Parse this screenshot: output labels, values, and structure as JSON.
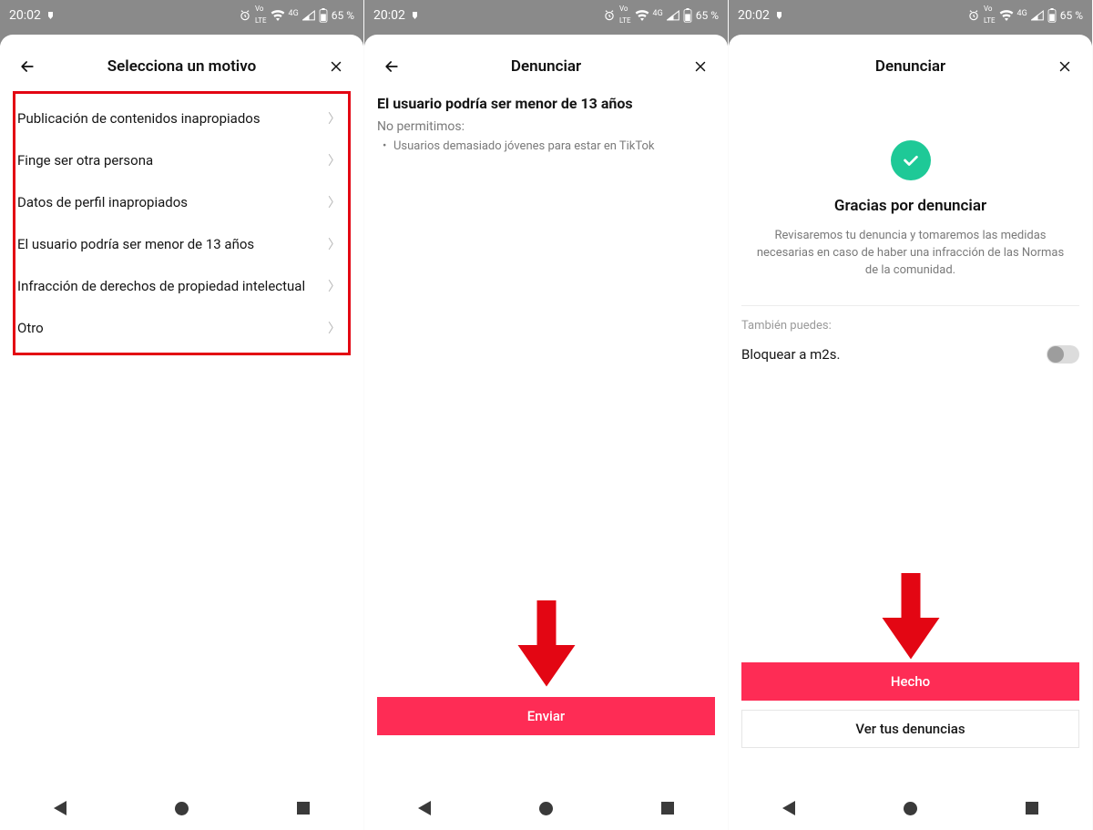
{
  "status": {
    "time": "20:02",
    "net_label": "LTE",
    "net_sup": "4G",
    "battery": "65 %"
  },
  "screen1": {
    "title": "Selecciona un motivo",
    "reasons": [
      "Publicación de contenidos inapropiados",
      "Finge ser otra persona",
      "Datos de perfil inapropiados",
      "El usuario podría ser menor de 13 años",
      "Infracción de derechos de propiedad intelectual",
      "Otro"
    ]
  },
  "screen2": {
    "title": "Denunciar",
    "heading": "El usuario podría ser menor de 13 años",
    "subtitle": "No permitimos:",
    "bullet": "Usuarios demasiado jóvenes para estar en TikTok",
    "submit": "Enviar"
  },
  "screen3": {
    "title": "Denunciar",
    "thanks_heading": "Gracias por denunciar",
    "thanks_body": "Revisaremos tu denuncia y tomaremos las medidas necesarias en caso de haber una infracción de las Normas de la comunidad.",
    "also": "También puedes:",
    "block_label": "Bloquear a m2s.",
    "done": "Hecho",
    "view_reports": "Ver tus denuncias"
  }
}
